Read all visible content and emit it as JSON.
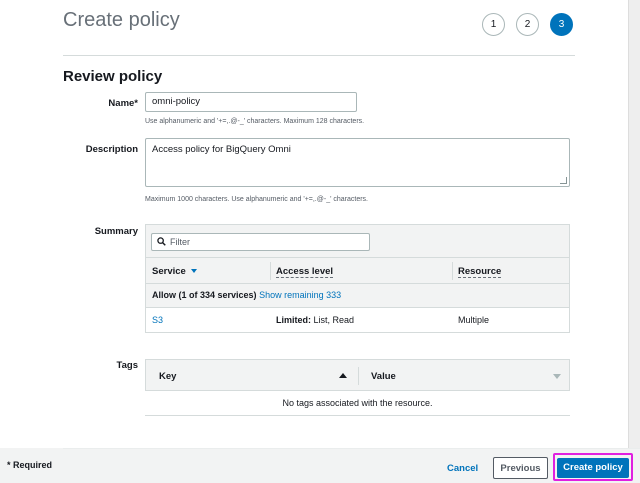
{
  "header": {
    "title": "Create policy",
    "steps": [
      "1",
      "2",
      "3"
    ],
    "active_step": "3"
  },
  "section": {
    "title": "Review policy"
  },
  "form": {
    "name_label": "Name*",
    "name_value": "omni-policy",
    "name_hint": "Use alphanumeric and '+=,.@-_' characters. Maximum 128 characters.",
    "description_label": "Description",
    "description_value": "Access policy for BigQuery Omni",
    "description_hint": "Maximum 1000 characters. Use alphanumeric and '+=,.@-_' characters."
  },
  "summary": {
    "label": "Summary",
    "filter_placeholder": "Filter",
    "columns": [
      "Service",
      "Access level",
      "Resource"
    ],
    "allow_text": "Allow (1 of 334 services)",
    "show_remaining": "Show remaining 333",
    "rows": [
      {
        "service": "S3",
        "access_bold": "Limited:",
        "access_rest": " List, Read",
        "resource": "Multiple"
      }
    ]
  },
  "tags": {
    "label": "Tags",
    "columns": [
      "Key",
      "Value"
    ],
    "empty_message": "No tags associated with the resource."
  },
  "footer": {
    "required_note": "* Required",
    "cancel_label": "Cancel",
    "previous_label": "Previous",
    "create_label": "Create policy"
  },
  "colors": {
    "accent": "#0073bb",
    "highlight": "#e020e0"
  },
  "icons": {
    "filter": "search-icon",
    "sort_service": "caret-down-icon",
    "sort_key": "sort-ascending-icon",
    "sort_value": "sort-descending-icon"
  }
}
